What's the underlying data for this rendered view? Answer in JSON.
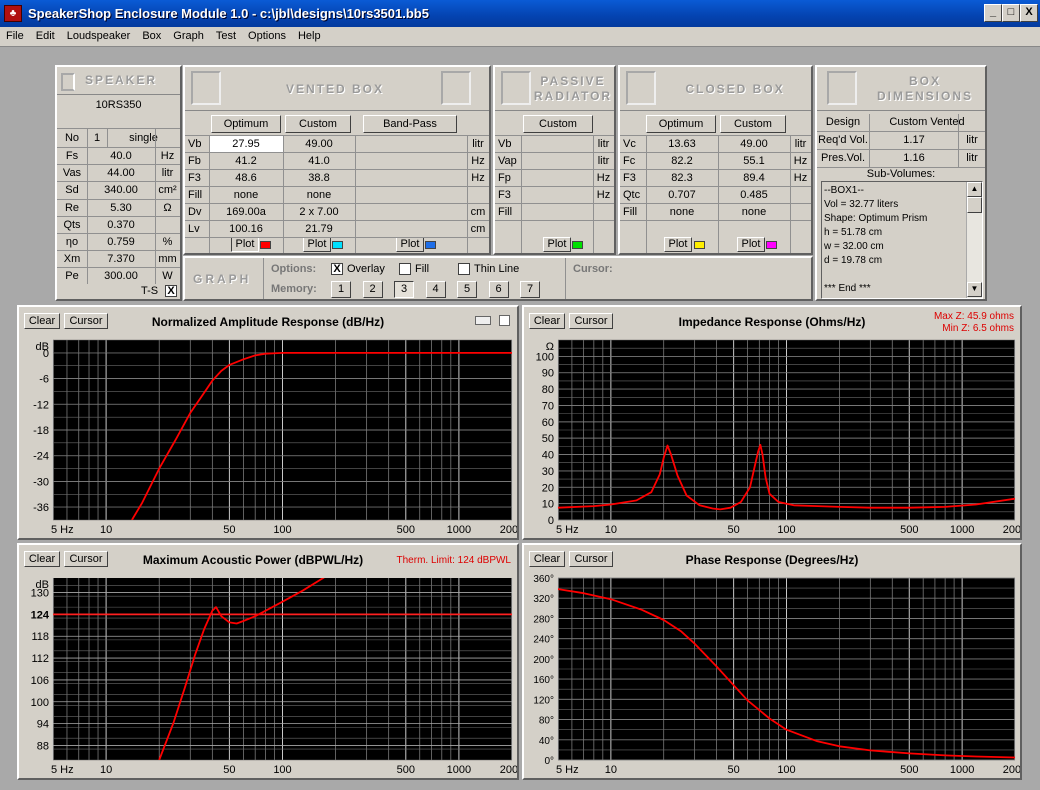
{
  "window": {
    "title": "SpeakerShop Enclosure Module 1.0 - c:\\jbl\\designs\\10rs3501.bb5",
    "minimize": "_",
    "maximize": "□",
    "close": "X"
  },
  "menu": [
    "File",
    "Edit",
    "Loudspeaker",
    "Box",
    "Graph",
    "Test",
    "Options",
    "Help"
  ],
  "speaker": {
    "header": "SPEAKER",
    "name": "10RS350",
    "no_label": "No",
    "no_value": "1",
    "mode": "single",
    "rows": [
      {
        "label": "Fs",
        "value": "40.0",
        "unit": "Hz"
      },
      {
        "label": "Vas",
        "value": "44.00",
        "unit": "litr"
      },
      {
        "label": "Sd",
        "value": "340.00",
        "unit": "cm²"
      },
      {
        "label": "Re",
        "value": "5.30",
        "unit": "Ω"
      },
      {
        "label": "Qts",
        "value": "0.370",
        "unit": ""
      },
      {
        "label": "ηo",
        "value": "0.759",
        "unit": "%"
      },
      {
        "label": "Xm",
        "value": "7.370",
        "unit": "mm"
      },
      {
        "label": "Pe",
        "value": "300.00",
        "unit": "W"
      }
    ],
    "ts_label": "T-S",
    "ts_checked": "X"
  },
  "vented": {
    "header": "VENTED BOX",
    "optimum": "Optimum",
    "custom": "Custom",
    "bandpass": "Band-Pass",
    "rows": [
      {
        "label": "Vb",
        "opt": "27.95",
        "cus": "49.00",
        "unit": "litr"
      },
      {
        "label": "Fb",
        "opt": "41.2",
        "cus": "41.0",
        "unit": "Hz"
      },
      {
        "label": "F3",
        "opt": "48.6",
        "cus": "38.8",
        "unit": "Hz"
      },
      {
        "label": "Fill",
        "opt": "none",
        "cus": "none",
        "unit": ""
      },
      {
        "label": "Dv",
        "opt": "169.00a",
        "cus": "2 x 7.00",
        "unit": "cm"
      },
      {
        "label": "Lv",
        "opt": "100.16",
        "cus": "21.79",
        "unit": "cm"
      }
    ],
    "plot": "Plot",
    "colors": [
      "#ff0000",
      "#00e0ff",
      "#1e6ee8"
    ]
  },
  "passive": {
    "header1": "PASSIVE",
    "header2": "RADIATOR",
    "custom": "Custom",
    "rows": [
      {
        "label": "Vb",
        "unit": "litr"
      },
      {
        "label": "Vap",
        "unit": "litr"
      },
      {
        "label": "Fp",
        "unit": "Hz"
      },
      {
        "label": "F3",
        "unit": "Hz"
      },
      {
        "label": "Fill",
        "unit": ""
      }
    ],
    "plot": "Plot",
    "color": "#00e000"
  },
  "closed": {
    "header": "CLOSED BOX",
    "optimum": "Optimum",
    "custom": "Custom",
    "rows": [
      {
        "label": "Vc",
        "opt": "13.63",
        "cus": "49.00",
        "unit": "litr"
      },
      {
        "label": "Fc",
        "opt": "82.2",
        "cus": "55.1",
        "unit": "Hz"
      },
      {
        "label": "F3",
        "opt": "82.3",
        "cus": "89.4",
        "unit": "Hz"
      },
      {
        "label": "Qtc",
        "opt": "0.707",
        "cus": "0.485",
        "unit": ""
      },
      {
        "label": "Fill",
        "opt": "none",
        "cus": "none",
        "unit": ""
      }
    ],
    "plot": "Plot",
    "colors": [
      "#ffee00",
      "#ff00ff"
    ]
  },
  "dims": {
    "header1": "BOX",
    "header2": "DIMENSIONS",
    "design_label": "Design",
    "design_value": "Custom Vented",
    "req_label": "Req'd Vol.",
    "req_value": "1.17",
    "req_unit": "litr",
    "pres_label": "Pres.Vol.",
    "pres_value": "1.16",
    "pres_unit": "litr",
    "sub_label": "Sub-Volumes:",
    "lines": [
      "--BOX1--",
      "Vol = 32.77 liters",
      "Shape: Optimum Prism",
      "h = 51.78 cm",
      "w = 32.00 cm",
      "d = 19.78 cm",
      "",
      "*** End ***"
    ]
  },
  "graph": {
    "header": "GRAPH",
    "options_label": "Options:",
    "overlay": "Overlay",
    "overlay_checked": "X",
    "fill": "Fill",
    "thin": "Thin Line",
    "cursor_label": "Cursor:",
    "memory_label": "Memory:",
    "memory": [
      "1",
      "2",
      "3",
      "4",
      "5",
      "6",
      "7"
    ],
    "memory_selected": "3"
  },
  "charts": {
    "clear": "Clear",
    "cursor": "Cursor",
    "amp": {
      "title": "Normalized Amplitude Response (dB/Hz)",
      "unit": "dB"
    },
    "imp": {
      "title": "Impedance Response (Ohms/Hz)",
      "unit": "Ω",
      "max_note": "Max Z: 45.9 ohms",
      "min_note": "Min Z: 6.5 ohms"
    },
    "pwr": {
      "title": "Maximum Acoustic Power (dBPWL/Hz)",
      "unit": "dB",
      "therm_note": "Therm. Limit: 124 dBPWL"
    },
    "phs": {
      "title": "Phase Response (Degrees/Hz)"
    }
  },
  "chart_data": [
    {
      "type": "line",
      "title": "Normalized Amplitude Response (dB/Hz)",
      "ylabel": "dB",
      "xscale": "log",
      "xlim": [
        5,
        2000
      ],
      "ylim": [
        -39,
        3
      ],
      "xticks": [
        "5 Hz",
        "10",
        "50",
        "100",
        "500",
        "1000",
        "2000"
      ],
      "yticks": [
        "0",
        "-6",
        "-12",
        "-18",
        "-24",
        "-30",
        "-36"
      ],
      "x": [
        14,
        16,
        20,
        25,
        30,
        35,
        40,
        45,
        50,
        60,
        70,
        80,
        100,
        150,
        200,
        500,
        1000,
        2000
      ],
      "series": [
        {
          "color": "#ff0000",
          "values": [
            -39,
            -35,
            -27,
            -20,
            -14,
            -10,
            -6.5,
            -4.2,
            -2.8,
            -1.5,
            -0.6,
            -0.2,
            0,
            0,
            0,
            0,
            0,
            0
          ]
        }
      ]
    },
    {
      "type": "line",
      "title": "Impedance Response (Ohms/Hz)",
      "ylabel": "Ω",
      "xscale": "log",
      "xlim": [
        5,
        2000
      ],
      "ylim": [
        0,
        110
      ],
      "max_note": "Max Z: 45.9 ohms",
      "min_note": "Min Z: 6.5 ohms",
      "xticks": [
        "5 Hz",
        "10",
        "50",
        "100",
        "500",
        "1000",
        "2000"
      ],
      "yticks": [
        "0",
        "10",
        "20",
        "30",
        "40",
        "50",
        "60",
        "70",
        "80",
        "90",
        "100"
      ],
      "x": [
        5,
        8,
        10,
        14,
        17,
        19,
        20,
        21,
        22,
        24,
        27,
        32,
        38,
        42,
        48,
        55,
        62,
        66,
        69,
        71,
        73,
        76,
        80,
        90,
        110,
        150,
        200,
        300,
        500,
        800,
        1200,
        2000
      ],
      "series": [
        {
          "color": "#ff0000",
          "values": [
            7.5,
            8.5,
            9.5,
            12,
            17,
            28,
            38,
            45.5,
            40,
            27,
            15,
            9,
            7,
            6.5,
            7.5,
            11,
            20,
            33,
            42,
            45.9,
            40,
            26,
            16,
            11,
            9,
            8.5,
            8,
            7.5,
            7.5,
            8,
            9.5,
            13
          ]
        }
      ]
    },
    {
      "type": "line",
      "title": "Maximum Acoustic Power (dBPWL/Hz)",
      "ylabel": "dB",
      "xscale": "log",
      "xlim": [
        5,
        2000
      ],
      "ylim": [
        84,
        134
      ],
      "therm_limit": 124,
      "therm_note": "Therm. Limit: 124 dBPWL",
      "xticks": [
        "5 Hz",
        "10",
        "50",
        "100",
        "500",
        "1000",
        "2000"
      ],
      "yticks": [
        "88",
        "94",
        "100",
        "106",
        "112",
        "118",
        "124",
        "130"
      ],
      "x": [
        20,
        24,
        28,
        32,
        36,
        40,
        42,
        45,
        50,
        55,
        60,
        70,
        80,
        100,
        130,
        170,
        210
      ],
      "series": [
        {
          "color": "#ff0000",
          "values": [
            84,
            94,
            104,
            113,
            120,
            125,
            126,
            123.5,
            121.8,
            121.5,
            122.2,
            123.5,
            125,
            127.5,
            130.5,
            134,
            137
          ]
        }
      ]
    },
    {
      "type": "line",
      "title": "Phase Response (Degrees/Hz)",
      "xscale": "log",
      "xlim": [
        5,
        2000
      ],
      "ylim": [
        0,
        360
      ],
      "xticks": [
        "5 Hz",
        "10",
        "50",
        "100",
        "500",
        "1000",
        "2000"
      ],
      "yticks": [
        "0°",
        "40°",
        "80°",
        "120°",
        "160°",
        "200°",
        "240°",
        "280°",
        "320°",
        "360°"
      ],
      "x": [
        5,
        7,
        10,
        15,
        20,
        25,
        30,
        40,
        50,
        60,
        80,
        100,
        150,
        200,
        300,
        500,
        800,
        1200,
        2000
      ],
      "series": [
        {
          "color": "#ff0000",
          "values": [
            338,
            330,
            318,
            297,
            277,
            255,
            230,
            185,
            148,
            118,
            82,
            60,
            37,
            27,
            19,
            13,
            9,
            7,
            5
          ]
        }
      ]
    }
  ]
}
